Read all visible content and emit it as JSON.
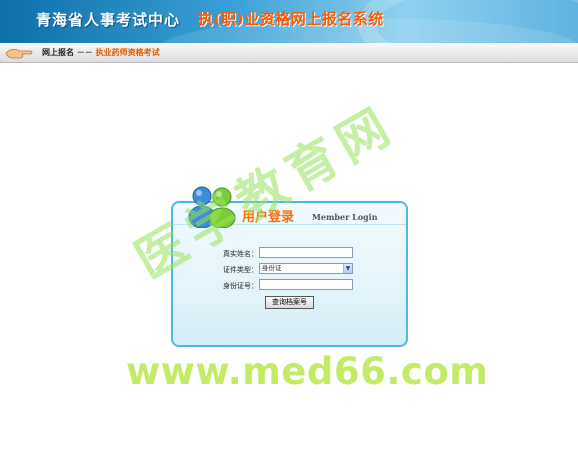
{
  "header": {
    "title": "青海省人事考试中心",
    "subtitle": "执(职)业资格网上报名系统"
  },
  "nav": {
    "breadcrumb_root": "网上报名",
    "separator": "－－",
    "breadcrumb_current": "执业药师资格考试"
  },
  "login": {
    "title": "用户登录",
    "title_en": "Member Login",
    "fields": [
      {
        "label": "真实姓名：",
        "value": ""
      },
      {
        "label": "证件类型：",
        "value": "身份证"
      },
      {
        "label": "身份证号：",
        "value": ""
      }
    ],
    "submit_label": "查询档案号"
  },
  "watermark": {
    "text": "医学教育网",
    "url": "www.med66.com"
  },
  "colors": {
    "header_blue": "#1a82c4",
    "title_orange": "#ff6a00",
    "panel_border": "#4fb8e6",
    "watermark_green": "#9ee05a"
  }
}
